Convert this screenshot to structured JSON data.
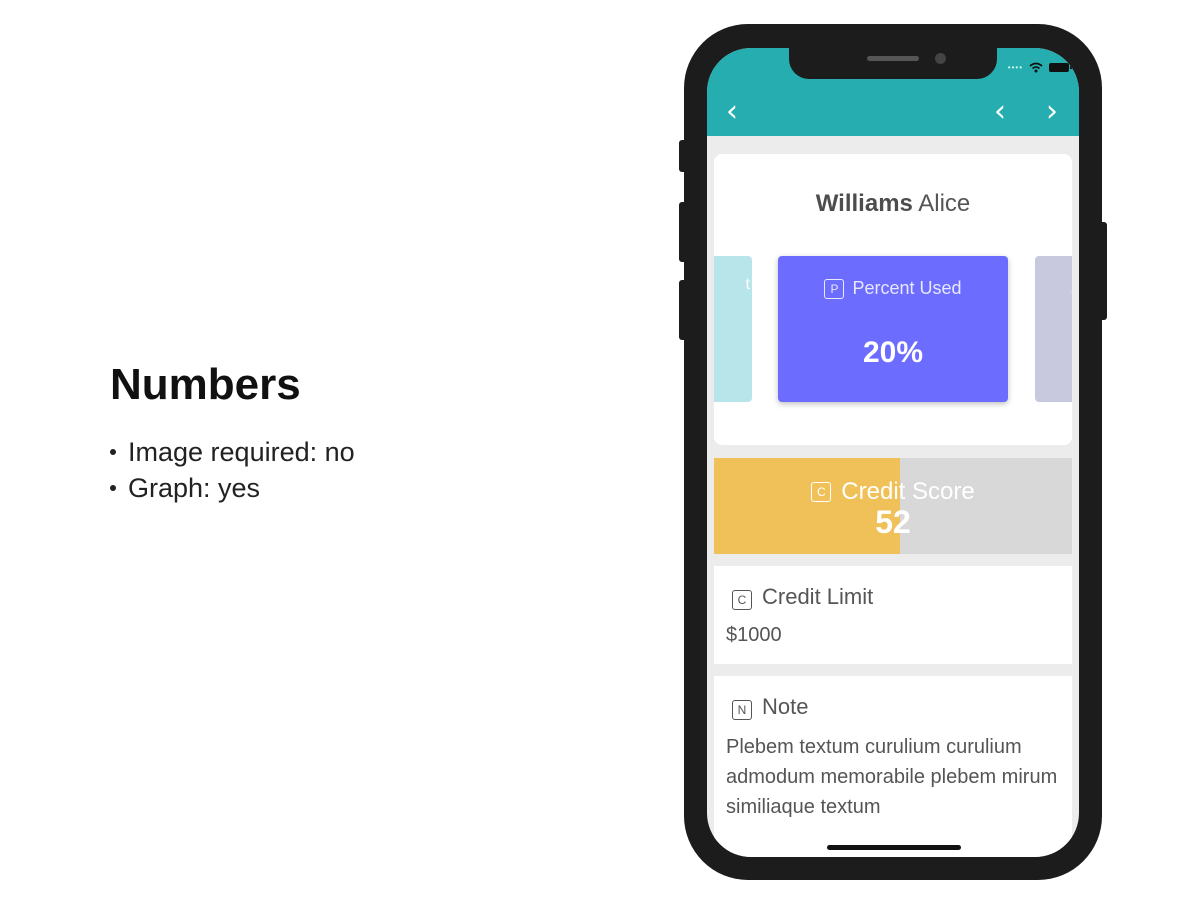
{
  "slide": {
    "title": "Numbers",
    "bullets": [
      "Image required: no",
      "Graph: yes"
    ]
  },
  "nav": {
    "back_icon": "chevron-left",
    "prev_icon": "chevron-left",
    "next_icon": "chevron-right",
    "back_glyph": "‹",
    "prev_glyph": "‹",
    "next_glyph": "›"
  },
  "profile": {
    "last_name": "Williams",
    "first_name": "Alice"
  },
  "tiles": {
    "left_peek": "t",
    "main": {
      "badge": "P",
      "label": "Percent Used",
      "value": "20%"
    }
  },
  "credit_score": {
    "badge": "C",
    "label": "Credit Score",
    "value": "52",
    "fill_fraction": 0.52
  },
  "credit_limit": {
    "badge": "C",
    "label": "Credit Limit",
    "value": "$1000"
  },
  "note": {
    "badge": "N",
    "label": "Note",
    "text": "Plebem textum curulium curulium admodum memorabile plebem mirum similiaque textum"
  },
  "colors": {
    "navbar": "#26adb0",
    "tile_main": "#6c6cff",
    "tile_left": "#b8e5ea",
    "tile_right": "#c8c9df",
    "score_fill": "#efc158",
    "score_track": "#d8d8d8"
  }
}
